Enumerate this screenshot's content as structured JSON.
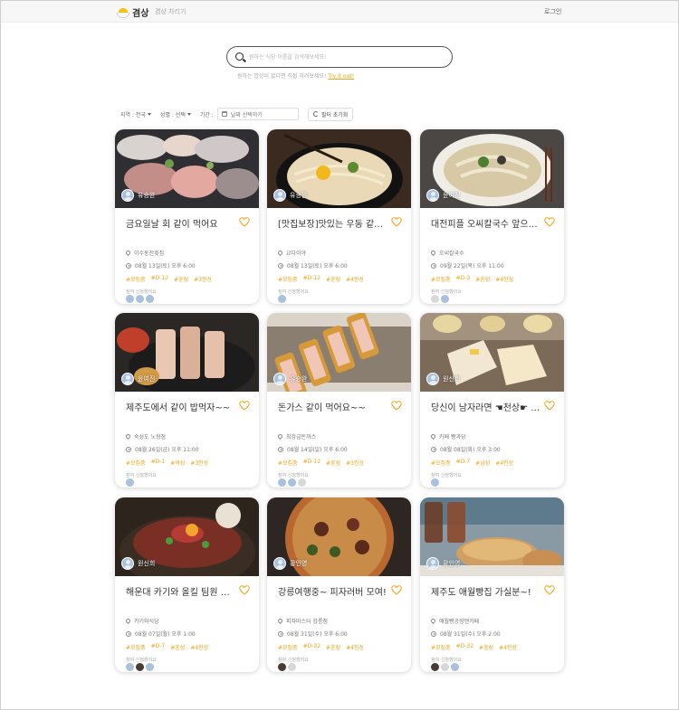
{
  "nav": {
    "logo_text": "겸상",
    "menu_link": "겸상 차리기",
    "login": "로그인"
  },
  "search": {
    "placeholder": "원하는 식당 이름을 검색해보세요!",
    "hint_prefix": "원하는 밥상이 없다면 직접 차려보세요!",
    "hint_link": "Try it out!"
  },
  "filters": {
    "region": "지역 : 전국",
    "gender": "성별 : 선택",
    "period_label": "기간 :",
    "date_placeholder": "날짜 선택하기",
    "reset": "필터 초기화"
  },
  "applicants_label": "참여 신청했어요",
  "colors": {
    "accent": "#f2a20f",
    "tag": "#f2a20f"
  },
  "cards": [
    {
      "author": "유승완",
      "title": "금요일날 회 같이 먹어요",
      "location": "이수동천횟집",
      "datetime": "08월 13일(토) 오후 6:00",
      "tags": [
        "#모집중",
        "#D-12",
        "#혼성",
        "#3인상"
      ],
      "participants": [
        "blue",
        "blue",
        "blue"
      ],
      "image": "sashimi-platter"
    },
    {
      "author": "유승완",
      "title": "[맛집보장]맛있는 우동 같이 먹어요",
      "location": "교다이야",
      "datetime": "08월 13일(토) 오후 6:00",
      "tags": [
        "#모집중",
        "#D-12",
        "#혼성",
        "#4인상"
      ],
      "participants": [
        "blue"
      ],
      "image": "udon-bowl"
    },
    {
      "author": "윤여진",
      "title": "대전피플 오씨칼국수 앞으로 모여라",
      "location": "오씨칼국수",
      "datetime": "09월 22일(목) 오후 11:00",
      "tags": [
        "#모집중",
        "#D-3",
        "#혼성",
        "#4인상"
      ],
      "participants": [
        "light",
        "blue"
      ],
      "image": "kalguksu"
    },
    {
      "author": "윤여진",
      "title": "제주도에서 같이 밥먹자~~",
      "location": "숙성도 노형점",
      "datetime": "08월 26일(금) 오후 11:00",
      "tags": [
        "#모집중",
        "#D-1",
        "#여성",
        "#3인상"
      ],
      "participants": [
        "blue"
      ],
      "image": "pork-grill"
    },
    {
      "author": "유승완",
      "title": "돈가스 같이 먹어요~~",
      "location": "최강금돈까스",
      "datetime": "08월 14일(일) 오후 6:00",
      "tags": [
        "#모집중",
        "#D-12",
        "#혼성",
        "#3인상"
      ],
      "participants": [
        "blue",
        "blue",
        "light"
      ],
      "image": "tonkatsu"
    },
    {
      "author": "원신희",
      "title": "당신이 남자라면 ☚천상☛ 오세요",
      "location": "카페 빵과당",
      "datetime": "08월 08일(화) 오후 3:00",
      "tags": [
        "#모집중",
        "#D-7",
        "#남성",
        "#4인상"
      ],
      "participants": [
        "blue"
      ],
      "image": "dessert-cafe"
    },
    {
      "author": "원신희",
      "title": "해운대 카기와 올킬 팀원 모집",
      "location": "카기와식당",
      "datetime": "08월 07일(월) 오후 1:00",
      "tags": [
        "#모집중",
        "#D-7",
        "#혼성",
        "#4인상"
      ],
      "participants": [
        "blue",
        "dark",
        "blue"
      ],
      "image": "beef-rice"
    },
    {
      "author": "황인영",
      "title": "강릉여행중~ 피자러버 모여!",
      "location": "피자마스터 강릉점",
      "datetime": "08월 31일(수) 오후 6:00",
      "tags": [
        "#모집중",
        "#D-32",
        "#혼성",
        "#4인상"
      ],
      "participants": [
        "dark",
        "light"
      ],
      "image": "pizza"
    },
    {
      "author": "황인영",
      "title": "제주도 애월빵집 가실분~!",
      "location": "애월빵공장앤카페",
      "datetime": "08월 31일(수) 오후 2:00",
      "tags": [
        "#모집중",
        "#D-32",
        "#혼성",
        "#4인상"
      ],
      "participants": [
        "dark",
        "light",
        "blue"
      ],
      "image": "bakery-sea"
    }
  ]
}
